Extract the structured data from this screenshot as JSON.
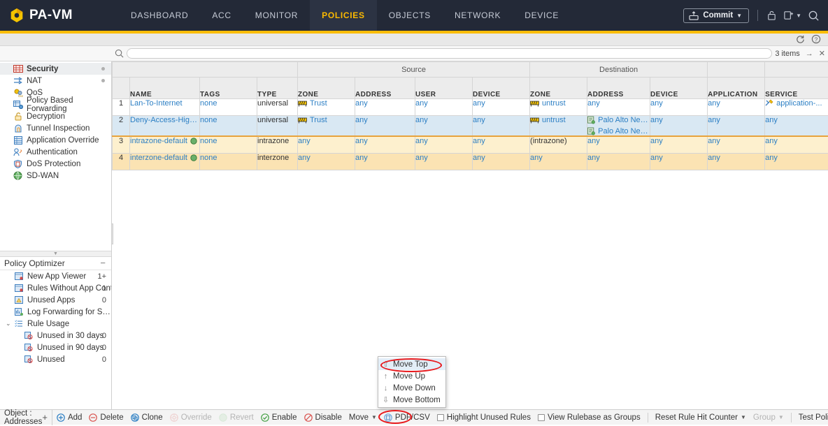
{
  "topnav": {
    "brand": "PA-VM",
    "tabs": [
      {
        "label": "DASHBOARD",
        "active": false
      },
      {
        "label": "ACC",
        "active": false
      },
      {
        "label": "MONITOR",
        "active": false
      },
      {
        "label": "POLICIES",
        "active": true
      },
      {
        "label": "OBJECTS",
        "active": false
      },
      {
        "label": "NETWORK",
        "active": false
      },
      {
        "label": "DEVICE",
        "active": false
      }
    ],
    "commit_label": "Commit",
    "icons": [
      "commit-icon",
      "lock-icon",
      "config-icon",
      "search-icon"
    ]
  },
  "subheader": {
    "refresh_icon": "refresh-icon",
    "help_icon": "help-icon"
  },
  "search": {
    "value": "",
    "placeholder": "",
    "items_count": "3 items"
  },
  "sidebar": {
    "policy_types": [
      {
        "label": "Security",
        "icon": "security-icon",
        "active": true,
        "dot": true
      },
      {
        "label": "NAT",
        "icon": "nat-icon",
        "active": false,
        "dot": true
      },
      {
        "label": "QoS",
        "icon": "qos-icon",
        "active": false,
        "dot": false
      },
      {
        "label": "Policy Based Forwarding",
        "icon": "pbf-icon",
        "active": false,
        "dot": false
      },
      {
        "label": "Decryption",
        "icon": "decryption-icon",
        "active": false,
        "dot": false
      },
      {
        "label": "Tunnel Inspection",
        "icon": "tunnel-icon",
        "active": false,
        "dot": false
      },
      {
        "label": "Application Override",
        "icon": "appoverride-icon",
        "active": false,
        "dot": false
      },
      {
        "label": "Authentication",
        "icon": "authentication-icon",
        "active": false,
        "dot": false
      },
      {
        "label": "DoS Protection",
        "icon": "dos-icon",
        "active": false,
        "dot": false
      },
      {
        "label": "SD-WAN",
        "icon": "sdwan-icon",
        "active": false,
        "dot": false
      }
    ],
    "optimizer": {
      "title": "Policy Optimizer",
      "collapse": "−",
      "items": [
        {
          "label": "New App Viewer",
          "count": "1+",
          "sub": false,
          "caret": ""
        },
        {
          "label": "Rules Without App Controls",
          "count": "1",
          "sub": false,
          "caret": ""
        },
        {
          "label": "Unused Apps",
          "count": "0",
          "sub": false,
          "caret": ""
        },
        {
          "label": "Log Forwarding for Security Ser",
          "count": "",
          "sub": false,
          "caret": ""
        },
        {
          "label": "Rule Usage",
          "count": "",
          "sub": false,
          "caret": "⌄"
        },
        {
          "label": "Unused in 30 days",
          "count": "0",
          "sub": true,
          "caret": ""
        },
        {
          "label": "Unused in 90 days",
          "count": "0",
          "sub": true,
          "caret": ""
        },
        {
          "label": "Unused",
          "count": "0",
          "sub": true,
          "caret": ""
        }
      ]
    }
  },
  "table": {
    "groups": [
      {
        "label": "",
        "span": 4
      },
      {
        "label": "Source",
        "span": 4
      },
      {
        "label": "Destination",
        "span": 3
      },
      {
        "label": "",
        "span": 1
      },
      {
        "label": "",
        "span": 1
      }
    ],
    "columns": [
      "",
      "NAME",
      "TAGS",
      "TYPE",
      "ZONE",
      "ADDRESS",
      "USER",
      "DEVICE",
      "ZONE",
      "ADDRESS",
      "DEVICE",
      "APPLICATION",
      "SERVICE"
    ],
    "rows": [
      {
        "num": "1",
        "name": "Lan-To-Internet",
        "tags": "none",
        "type": "universal",
        "src_zone": [
          {
            "text": "Trust",
            "icon": "zone-icon"
          }
        ],
        "src_address": [
          "any"
        ],
        "src_user": [
          "any"
        ],
        "src_device": [
          "any"
        ],
        "dst_zone": [
          {
            "text": "untrust",
            "icon": "zone-icon"
          }
        ],
        "dst_address": [
          {
            "text": "any",
            "icon": ""
          }
        ],
        "dst_device": [
          "any"
        ],
        "application": [
          "any"
        ],
        "service": [
          {
            "text": "application-...",
            "icon": "service-icon"
          }
        ],
        "state": "normal"
      },
      {
        "num": "2",
        "name": "Deny-Access-High-R...",
        "tags": "none",
        "type": "universal",
        "src_zone": [
          {
            "text": "Trust",
            "icon": "zone-icon"
          }
        ],
        "src_address": [
          "any"
        ],
        "src_user": [
          "any"
        ],
        "src_device": [
          "any"
        ],
        "dst_zone": [
          {
            "text": "untrust",
            "icon": "zone-icon"
          }
        ],
        "dst_address": [
          {
            "text": "Palo Alto Netw...",
            "icon": "address-icon"
          },
          {
            "text": "Palo Alto Netw...",
            "icon": "address-icon"
          }
        ],
        "dst_device": [
          "any"
        ],
        "application": [
          "any"
        ],
        "service": [
          {
            "text": "any",
            "icon": ""
          }
        ],
        "state": "selected"
      },
      {
        "num": "3",
        "name": "intrazone-default",
        "tags": "none",
        "type": "intrazone",
        "src_zone": [
          {
            "text": "any",
            "icon": ""
          }
        ],
        "src_address": [
          "any"
        ],
        "src_user": [
          "any"
        ],
        "src_device": [
          "any"
        ],
        "dst_zone": [
          {
            "text": "(intrazone)",
            "icon": "",
            "plain": true
          }
        ],
        "dst_address": [
          {
            "text": "any",
            "icon": ""
          }
        ],
        "dst_device": [
          "any"
        ],
        "application": [
          "any"
        ],
        "service": [
          {
            "text": "any",
            "icon": ""
          }
        ],
        "state": "default1"
      },
      {
        "num": "4",
        "name": "interzone-default",
        "tags": "none",
        "type": "interzone",
        "src_zone": [
          {
            "text": "any",
            "icon": ""
          }
        ],
        "src_address": [
          "any"
        ],
        "src_user": [
          "any"
        ],
        "src_device": [
          "any"
        ],
        "dst_zone": [
          {
            "text": "any",
            "icon": ""
          }
        ],
        "dst_address": [
          {
            "text": "any",
            "icon": ""
          }
        ],
        "dst_device": [
          "any"
        ],
        "application": [
          "any"
        ],
        "service": [
          {
            "text": "any",
            "icon": ""
          }
        ],
        "state": "default2"
      }
    ]
  },
  "move_menu": {
    "items": [
      {
        "label": "Move Top",
        "arrow": "⇧",
        "highlighted": true
      },
      {
        "label": "Move Up",
        "arrow": "↑",
        "highlighted": false
      },
      {
        "label": "Move Down",
        "arrow": "↓",
        "highlighted": false
      },
      {
        "label": "Move Bottom",
        "arrow": "⇩",
        "highlighted": false
      }
    ]
  },
  "bottombar": {
    "object_label": "Object : Addresses",
    "object_plus": "+",
    "buttons": [
      {
        "label": "Add",
        "icon": "plus-circle-icon",
        "disabled": false,
        "color": "#2c7fc4"
      },
      {
        "label": "Delete",
        "icon": "minus-circle-icon",
        "disabled": false,
        "color": "#d9534f"
      },
      {
        "label": "Clone",
        "icon": "clone-icon",
        "disabled": false,
        "color": "#2c7fc4"
      },
      {
        "label": "Override",
        "icon": "override-icon",
        "disabled": true,
        "color": "#f2b6b4"
      },
      {
        "label": "Revert",
        "icon": "revert-icon",
        "disabled": true,
        "color": "#b9ddb9"
      },
      {
        "label": "Enable",
        "icon": "check-circle-icon",
        "disabled": false,
        "color": "#46a146"
      },
      {
        "label": "Disable",
        "icon": "ban-icon",
        "disabled": false,
        "color": "#d9534f"
      }
    ],
    "move_label": "Move",
    "pdf_label": "PDF/CSV",
    "checkboxes": [
      {
        "label": "Highlight Unused Rules",
        "checked": false
      },
      {
        "label": "View Rulebase as Groups",
        "checked": false
      }
    ],
    "reset_label": "Reset Rule Hit Counter",
    "group_label": "Group",
    "test_label": "Test Policy Match"
  },
  "colors": {
    "navbar": "#232937",
    "accent_yellow": "#fbbd08",
    "active_tab_text": "#fbb900",
    "link_blue": "#2c7fc4",
    "row_selected": "#d9e8f3",
    "row_default_light": "#fdf0ce",
    "row_default_dark": "#fbe3b3",
    "default_divider": "#e8a33d",
    "annotation_red": "#e8191c"
  }
}
